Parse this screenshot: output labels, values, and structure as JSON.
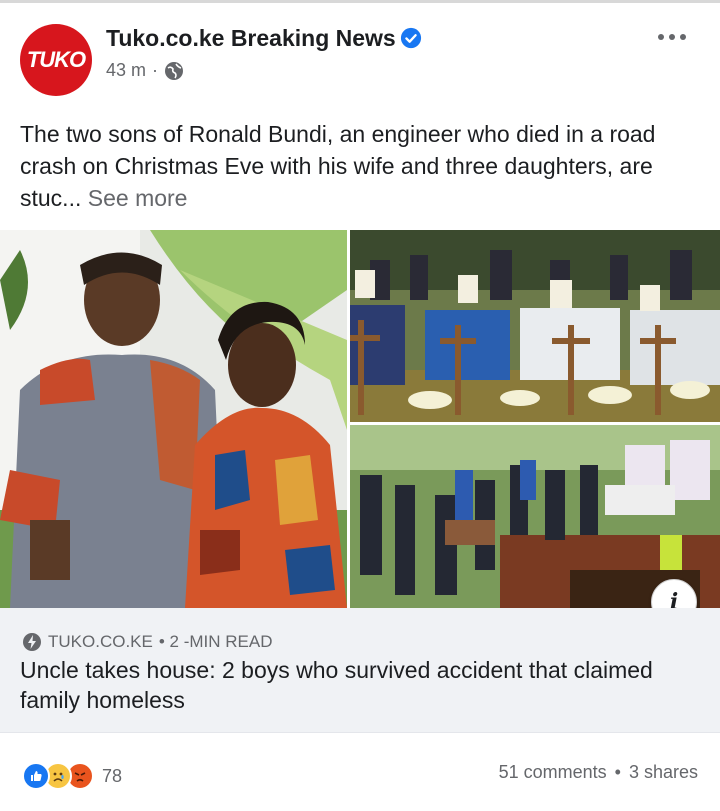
{
  "post": {
    "page_name": "Tuko.co.ke Breaking News",
    "avatar_text": "TUKO",
    "time": "43 m",
    "separator": "·",
    "text": "The two sons of Ronald Bundi, an engineer who died in a road crash on Christmas Eve with his wife and three daughters, are stuc...",
    "see_more": "See more"
  },
  "link": {
    "source": "TUKO.CO.KE",
    "read_time": "• 2 -MIN READ",
    "title": "Uncle takes house: 2 boys who survived accident that claimed family homeless"
  },
  "footer": {
    "reaction_count": "78",
    "comments": "51 comments",
    "dot": "•",
    "shares": "3 shares",
    "reactions": [
      "like-icon",
      "sad-icon",
      "angry-icon"
    ]
  },
  "icons": {
    "verified": "verified-badge-icon",
    "globe": "globe-icon",
    "more": "more-options-icon",
    "info": "info-icon",
    "bolt": "lightning-icon"
  },
  "colors": {
    "brand": "#d7161d",
    "link_bg": "#f0f2f5",
    "secondary_text": "#65676b",
    "verified_blue": "#1877f2"
  }
}
